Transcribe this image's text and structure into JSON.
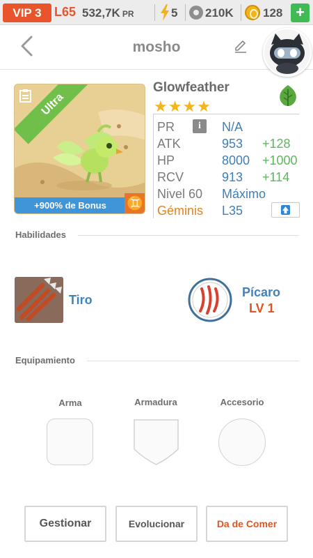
{
  "topbar": {
    "vip": "VIP 3",
    "level": "L65",
    "power": "532,7K",
    "power_unit": "PR",
    "energy": "5",
    "paws": "210K",
    "coins": "128",
    "add_label": "+"
  },
  "header": {
    "title": "mosho"
  },
  "monster": {
    "name": "Glowfeather",
    "rarity": "Ultra",
    "stars": "★★★★",
    "bonus": "+900% de Bonus",
    "element": "leaf-icon"
  },
  "stats": {
    "pr_label": "PR",
    "pr_value": "N/A",
    "atk_label": "ATK",
    "atk_value": "953",
    "atk_bonus": "+128",
    "hp_label": "HP",
    "hp_value": "8000",
    "hp_bonus": "+1000",
    "rcv_label": "RCV",
    "rcv_value": "913",
    "rcv_bonus": "+114",
    "level_label": "Nivel 60",
    "level_value": "Máximo",
    "zodiac_label": "Géminis",
    "zodiac_value": "L35"
  },
  "skills": {
    "section_title": "Habilidades",
    "skill1_name": "Tiro",
    "skill2_name": "Pícaro",
    "skill2_level": "LV 1"
  },
  "equipment": {
    "section_title": "Equipamiento",
    "weapon": "Arma",
    "armor": "Armadura",
    "accessory": "Accesorio"
  },
  "actions": {
    "manage": "Gestionar",
    "evolve": "Evolucionar",
    "feed": "Da de Comer"
  },
  "colors": {
    "accent_orange": "#e8542c",
    "accent_blue": "#3f82c0",
    "accent_green": "#5cb85c"
  }
}
